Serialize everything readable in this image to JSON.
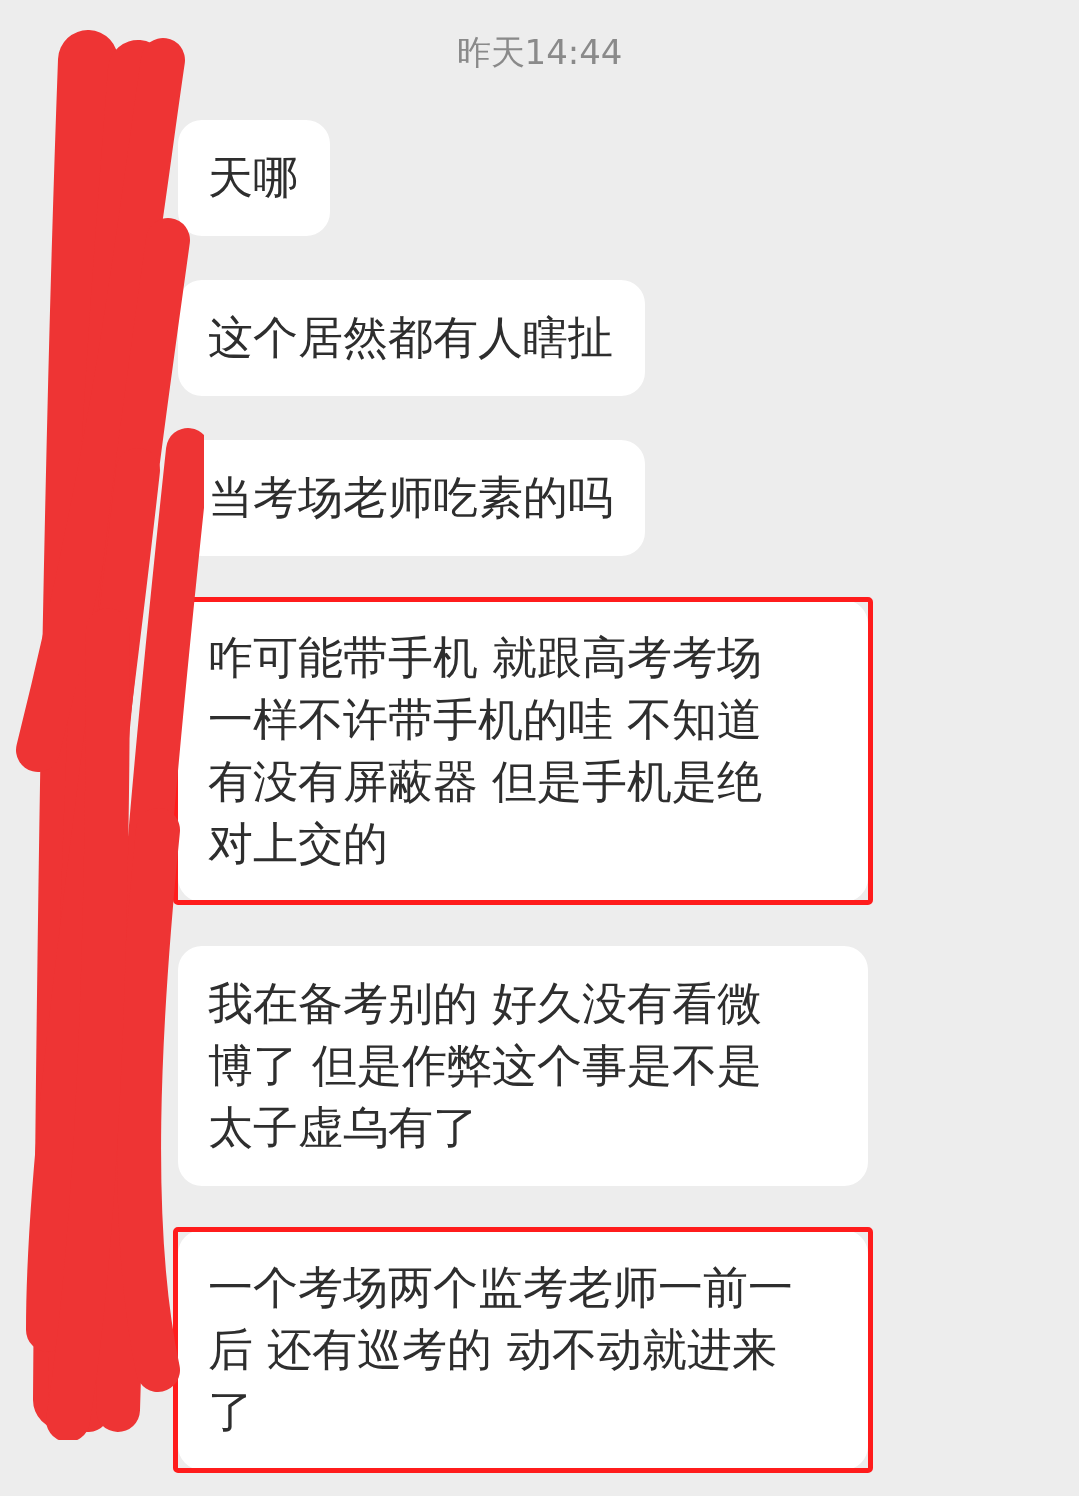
{
  "timestamp": "昨天14:44",
  "messages": [
    {
      "lines": [
        "天哪"
      ],
      "highlighted": false
    },
    {
      "lines": [
        "这个居然都有人瞎扯"
      ],
      "highlighted": false
    },
    {
      "lines": [
        "当考场老师吃素的吗"
      ],
      "highlighted": false
    },
    {
      "lines": [
        "咋可能带手机 就跟高考考场",
        "一样不许带手机的哇 不知道",
        "有没有屏蔽器 但是手机是绝",
        "对上交的"
      ],
      "highlighted": true
    },
    {
      "lines": [
        "我在备考别的 好久没有看微",
        "博了 但是作弊这个事是不是",
        "太子虚乌有了"
      ],
      "highlighted": false
    },
    {
      "lines": [
        "一个考场两个监考老师一前一",
        "后 还有巡考的 动不动就进来",
        "了"
      ],
      "highlighted": true
    }
  ]
}
